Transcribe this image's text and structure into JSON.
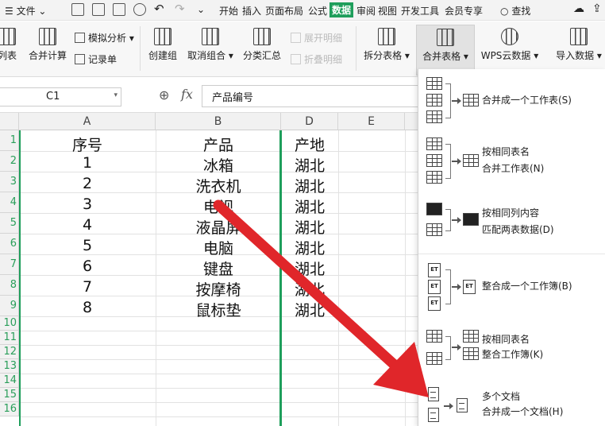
{
  "menubar": {
    "hamburger_label": "文件",
    "tabs": [
      "开始",
      "插入",
      "页面布局",
      "公式",
      "数据",
      "审阅",
      "视图",
      "开发工具",
      "会员专享"
    ],
    "active_tab": "数据",
    "search_label": "查找"
  },
  "ribbon": {
    "list_label": "列表",
    "merge_calc_label": "合并计算",
    "simulate_label": "模拟分析",
    "record_label": "记录单",
    "create_group_label": "创建组",
    "ungroup_label": "取消组合",
    "subtotal_label": "分类汇总",
    "expand_detail_label": "展开明细",
    "collapse_detail_label": "折叠明细",
    "split_table_label": "拆分表格",
    "merge_table_label": "合并表格",
    "wps_cloud_label": "WPS云数据",
    "import_data_label": "导入数据"
  },
  "formula_bar": {
    "name_box_value": "C1",
    "zoom_icon": "magnify-icon",
    "fx_label": "fx",
    "formula_value": "产品编号"
  },
  "grid": {
    "columns": [
      "A",
      "B",
      "D",
      "E"
    ],
    "rows": [
      "1",
      "2",
      "3",
      "4",
      "5",
      "6",
      "7",
      "8",
      "9",
      "10",
      "11",
      "12",
      "13",
      "14",
      "15",
      "16"
    ],
    "header_row": {
      "a": "序号",
      "b": "产品",
      "d": "产地"
    },
    "data": [
      {
        "a": "1",
        "b": "冰箱",
        "d": "湖北"
      },
      {
        "a": "2",
        "b": "洗衣机",
        "d": "湖北"
      },
      {
        "a": "3",
        "b": "电视",
        "d": "湖北"
      },
      {
        "a": "4",
        "b": "液晶屏",
        "d": "湖北"
      },
      {
        "a": "5",
        "b": "电脑",
        "d": "湖北"
      },
      {
        "a": "6",
        "b": "键盘",
        "d": "湖北"
      },
      {
        "a": "7",
        "b": "按摩椅",
        "d": "湖北"
      },
      {
        "a": "8",
        "b": "鼠标垫",
        "d": "湖北"
      }
    ]
  },
  "dropdown": {
    "items": [
      {
        "line1": "合并成一个工作表(S)",
        "line2": ""
      },
      {
        "line1": "按相同表名",
        "line2": "合并工作表(N)"
      },
      {
        "line1": "按相同列内容",
        "line2": "匹配两表数据(D)"
      },
      {
        "line1": "整合成一个工作簿(B)",
        "line2": ""
      },
      {
        "line1": "按相同表名",
        "line2": "整合工作簿(K)"
      },
      {
        "line1": "多个文档",
        "line2": "合并成一个文档(H)"
      }
    ]
  },
  "annotation": {
    "arrow_color": "#e0262a"
  },
  "colors": {
    "accent": "#1e9e5b"
  }
}
